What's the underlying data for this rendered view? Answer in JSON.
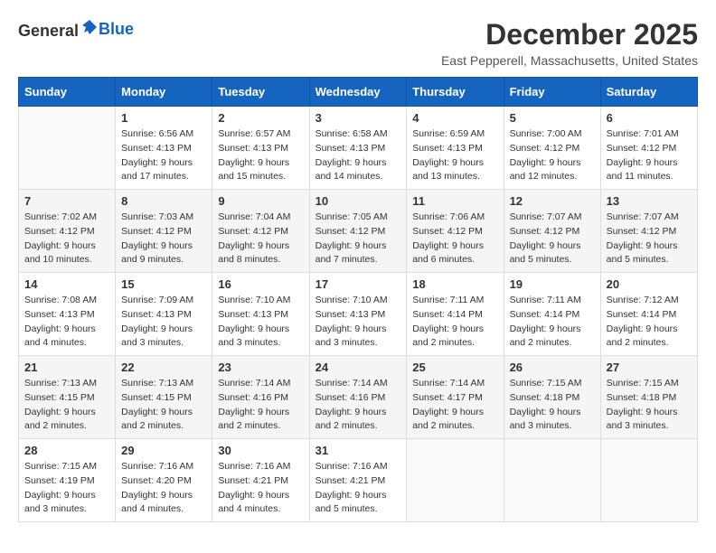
{
  "header": {
    "logo_general": "General",
    "logo_blue": "Blue",
    "month": "December 2025",
    "location": "East Pepperell, Massachusetts, United States"
  },
  "days_of_week": [
    "Sunday",
    "Monday",
    "Tuesday",
    "Wednesday",
    "Thursday",
    "Friday",
    "Saturday"
  ],
  "weeks": [
    [
      {
        "day": "",
        "sunrise": "",
        "sunset": "",
        "daylight": ""
      },
      {
        "day": "1",
        "sunrise": "Sunrise: 6:56 AM",
        "sunset": "Sunset: 4:13 PM",
        "daylight": "Daylight: 9 hours and 17 minutes."
      },
      {
        "day": "2",
        "sunrise": "Sunrise: 6:57 AM",
        "sunset": "Sunset: 4:13 PM",
        "daylight": "Daylight: 9 hours and 15 minutes."
      },
      {
        "day": "3",
        "sunrise": "Sunrise: 6:58 AM",
        "sunset": "Sunset: 4:13 PM",
        "daylight": "Daylight: 9 hours and 14 minutes."
      },
      {
        "day": "4",
        "sunrise": "Sunrise: 6:59 AM",
        "sunset": "Sunset: 4:13 PM",
        "daylight": "Daylight: 9 hours and 13 minutes."
      },
      {
        "day": "5",
        "sunrise": "Sunrise: 7:00 AM",
        "sunset": "Sunset: 4:12 PM",
        "daylight": "Daylight: 9 hours and 12 minutes."
      },
      {
        "day": "6",
        "sunrise": "Sunrise: 7:01 AM",
        "sunset": "Sunset: 4:12 PM",
        "daylight": "Daylight: 9 hours and 11 minutes."
      }
    ],
    [
      {
        "day": "7",
        "sunrise": "Sunrise: 7:02 AM",
        "sunset": "Sunset: 4:12 PM",
        "daylight": "Daylight: 9 hours and 10 minutes."
      },
      {
        "day": "8",
        "sunrise": "Sunrise: 7:03 AM",
        "sunset": "Sunset: 4:12 PM",
        "daylight": "Daylight: 9 hours and 9 minutes."
      },
      {
        "day": "9",
        "sunrise": "Sunrise: 7:04 AM",
        "sunset": "Sunset: 4:12 PM",
        "daylight": "Daylight: 9 hours and 8 minutes."
      },
      {
        "day": "10",
        "sunrise": "Sunrise: 7:05 AM",
        "sunset": "Sunset: 4:12 PM",
        "daylight": "Daylight: 9 hours and 7 minutes."
      },
      {
        "day": "11",
        "sunrise": "Sunrise: 7:06 AM",
        "sunset": "Sunset: 4:12 PM",
        "daylight": "Daylight: 9 hours and 6 minutes."
      },
      {
        "day": "12",
        "sunrise": "Sunrise: 7:07 AM",
        "sunset": "Sunset: 4:12 PM",
        "daylight": "Daylight: 9 hours and 5 minutes."
      },
      {
        "day": "13",
        "sunrise": "Sunrise: 7:07 AM",
        "sunset": "Sunset: 4:12 PM",
        "daylight": "Daylight: 9 hours and 5 minutes."
      }
    ],
    [
      {
        "day": "14",
        "sunrise": "Sunrise: 7:08 AM",
        "sunset": "Sunset: 4:13 PM",
        "daylight": "Daylight: 9 hours and 4 minutes."
      },
      {
        "day": "15",
        "sunrise": "Sunrise: 7:09 AM",
        "sunset": "Sunset: 4:13 PM",
        "daylight": "Daylight: 9 hours and 3 minutes."
      },
      {
        "day": "16",
        "sunrise": "Sunrise: 7:10 AM",
        "sunset": "Sunset: 4:13 PM",
        "daylight": "Daylight: 9 hours and 3 minutes."
      },
      {
        "day": "17",
        "sunrise": "Sunrise: 7:10 AM",
        "sunset": "Sunset: 4:13 PM",
        "daylight": "Daylight: 9 hours and 3 minutes."
      },
      {
        "day": "18",
        "sunrise": "Sunrise: 7:11 AM",
        "sunset": "Sunset: 4:14 PM",
        "daylight": "Daylight: 9 hours and 2 minutes."
      },
      {
        "day": "19",
        "sunrise": "Sunrise: 7:11 AM",
        "sunset": "Sunset: 4:14 PM",
        "daylight": "Daylight: 9 hours and 2 minutes."
      },
      {
        "day": "20",
        "sunrise": "Sunrise: 7:12 AM",
        "sunset": "Sunset: 4:14 PM",
        "daylight": "Daylight: 9 hours and 2 minutes."
      }
    ],
    [
      {
        "day": "21",
        "sunrise": "Sunrise: 7:13 AM",
        "sunset": "Sunset: 4:15 PM",
        "daylight": "Daylight: 9 hours and 2 minutes."
      },
      {
        "day": "22",
        "sunrise": "Sunrise: 7:13 AM",
        "sunset": "Sunset: 4:15 PM",
        "daylight": "Daylight: 9 hours and 2 minutes."
      },
      {
        "day": "23",
        "sunrise": "Sunrise: 7:14 AM",
        "sunset": "Sunset: 4:16 PM",
        "daylight": "Daylight: 9 hours and 2 minutes."
      },
      {
        "day": "24",
        "sunrise": "Sunrise: 7:14 AM",
        "sunset": "Sunset: 4:16 PM",
        "daylight": "Daylight: 9 hours and 2 minutes."
      },
      {
        "day": "25",
        "sunrise": "Sunrise: 7:14 AM",
        "sunset": "Sunset: 4:17 PM",
        "daylight": "Daylight: 9 hours and 2 minutes."
      },
      {
        "day": "26",
        "sunrise": "Sunrise: 7:15 AM",
        "sunset": "Sunset: 4:18 PM",
        "daylight": "Daylight: 9 hours and 3 minutes."
      },
      {
        "day": "27",
        "sunrise": "Sunrise: 7:15 AM",
        "sunset": "Sunset: 4:18 PM",
        "daylight": "Daylight: 9 hours and 3 minutes."
      }
    ],
    [
      {
        "day": "28",
        "sunrise": "Sunrise: 7:15 AM",
        "sunset": "Sunset: 4:19 PM",
        "daylight": "Daylight: 9 hours and 3 minutes."
      },
      {
        "day": "29",
        "sunrise": "Sunrise: 7:16 AM",
        "sunset": "Sunset: 4:20 PM",
        "daylight": "Daylight: 9 hours and 4 minutes."
      },
      {
        "day": "30",
        "sunrise": "Sunrise: 7:16 AM",
        "sunset": "Sunset: 4:21 PM",
        "daylight": "Daylight: 9 hours and 4 minutes."
      },
      {
        "day": "31",
        "sunrise": "Sunrise: 7:16 AM",
        "sunset": "Sunset: 4:21 PM",
        "daylight": "Daylight: 9 hours and 5 minutes."
      },
      {
        "day": "",
        "sunrise": "",
        "sunset": "",
        "daylight": ""
      },
      {
        "day": "",
        "sunrise": "",
        "sunset": "",
        "daylight": ""
      },
      {
        "day": "",
        "sunrise": "",
        "sunset": "",
        "daylight": ""
      }
    ]
  ]
}
